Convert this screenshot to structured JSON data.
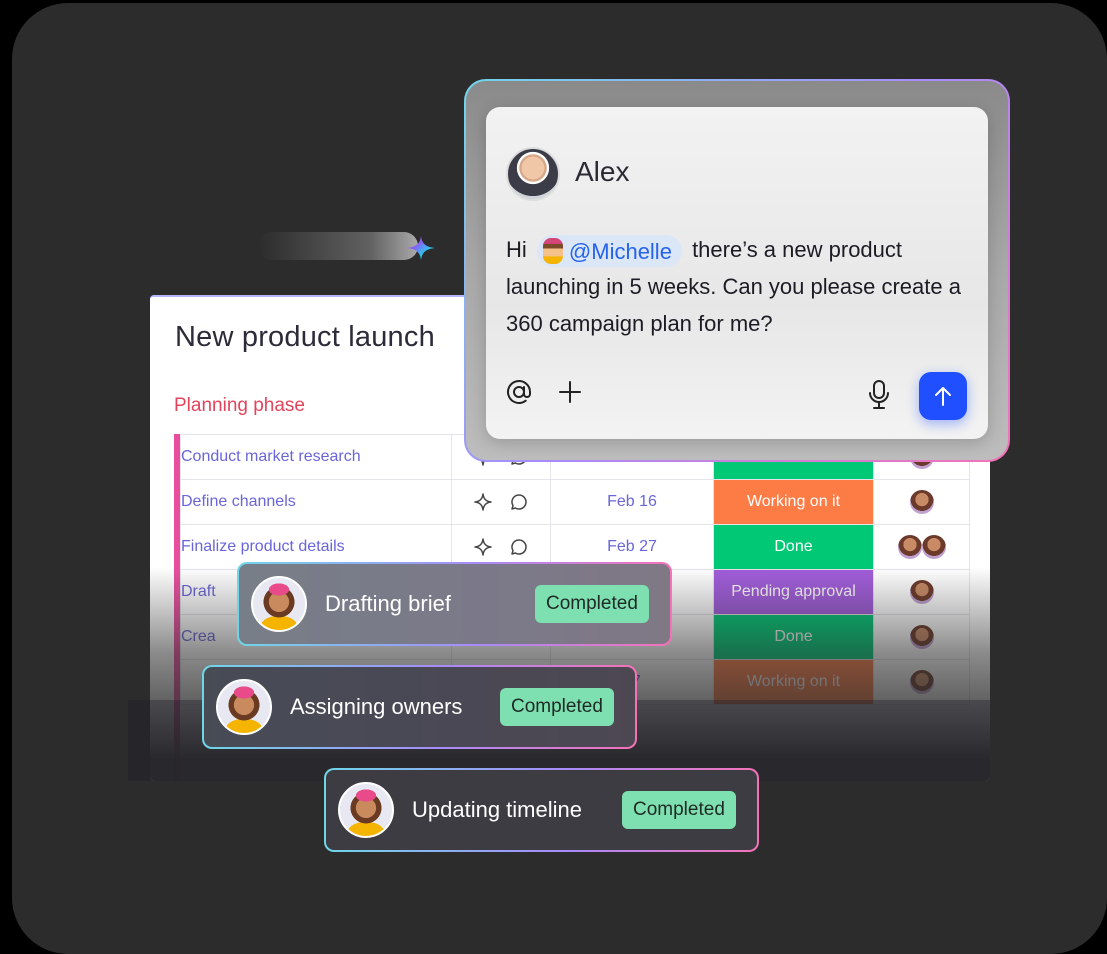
{
  "board": {
    "title": "New product launch",
    "group_title": "Planning phase",
    "rows": [
      {
        "name": "Conduct market research",
        "date": "",
        "status": "",
        "status_color": "#00c875",
        "owners": [
          "owner-1"
        ]
      },
      {
        "name": "Define channels",
        "date": "Feb 16",
        "status": "Working on it",
        "status_color": "#fd7b45",
        "owners": [
          "owner-1"
        ]
      },
      {
        "name": "Finalize product details",
        "date": "Feb 27",
        "status": "Done",
        "status_color": "#00c875",
        "owners": [
          "owner-2",
          "owner-3"
        ]
      },
      {
        "name": "Draft",
        "date": "",
        "status": "Pending approval",
        "status_color": "#a25ddc",
        "owners": [
          "owner-1"
        ]
      },
      {
        "name": "Crea",
        "date": "",
        "status": "Done",
        "status_color": "#00c875",
        "owners": [
          "owner-4"
        ]
      },
      {
        "name": "",
        "date": "27",
        "status": "Working on it",
        "status_color": "#fd7b45",
        "owners": [
          "owner-5"
        ]
      }
    ]
  },
  "chat": {
    "author": "Alex",
    "msg_before": "Hi",
    "mention": "@Michelle",
    "msg_after": "there’s a new product launching in 5 weeks. Can you please create a 360 campaign plan for me?",
    "tools": [
      "at-sign-icon",
      "plus-icon",
      "microphone-icon",
      "send-arrow-icon"
    ]
  },
  "progress": [
    {
      "label": "Drafting brief",
      "status": "Completed"
    },
    {
      "label": "Assigning owners",
      "status": "Completed"
    },
    {
      "label": "Updating timeline",
      "status": "Completed"
    }
  ],
  "colors": {
    "accent": "#1f4fff",
    "group": "#e2445c",
    "completed_badge": "#7ee0b0",
    "stage_bg": "#2c2c2c"
  }
}
